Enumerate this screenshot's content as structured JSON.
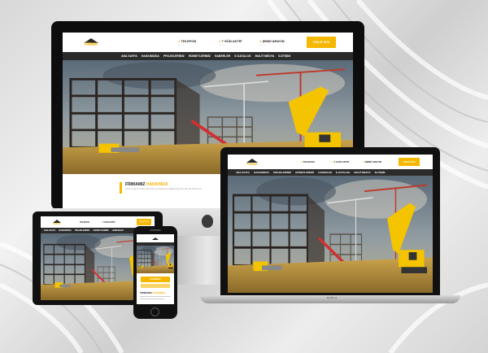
{
  "site": {
    "logo_text": "FİRMA",
    "logo_sub": "İnşaat",
    "contact_phone_label": "TELEFON",
    "contact_time_label": "7 GÜN AKTİF",
    "contact_quote_label": "ŞİMDİ ARAYIN",
    "cta_label": "TEKLİF İSTE",
    "nav": [
      "ANA SAYFA",
      "HAKKIMIZDA",
      "PROJELERİMİZ",
      "HİZMETLERİMİZ",
      "HABERLER",
      "E-KATALOG",
      "MULTİ MEDYA",
      "İLETİŞİM"
    ],
    "section_title": "FİRMAMIZ",
    "section_highlight": "HAKKINDA",
    "section_text": "Lorem ipsum dolor sit amet consectetur adipiscing elit sed do eiusmod."
  },
  "phone_site": {
    "card_label": "HAKKINDA",
    "section_title": "FİRMAMIZ",
    "section_highlight": "HAKKINDA"
  },
  "laptop_brand": "MacBook",
  "colors": {
    "accent": "#f5b800",
    "nav": "#2b2b2b",
    "frame": "#111111"
  }
}
